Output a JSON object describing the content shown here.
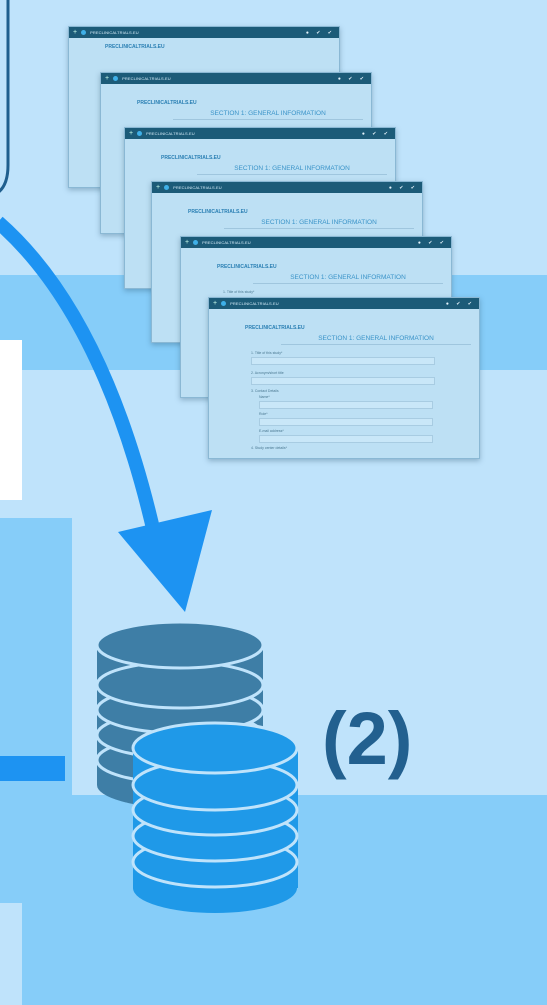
{
  "screens": {
    "site_name": "PRECLINICALTRIALS.EU",
    "logo": "PRECLINICALTRIALS.EU",
    "section_title": "SECTION 1: GENERAL INFORMATION",
    "fields": {
      "title": "1. Title of this study*",
      "acronym": "2. Acronym/short title",
      "contact": "3. Contact Details",
      "name": "Name*",
      "role": "Role*",
      "email": "E-mail address*",
      "centre": "4. Study center details*"
    }
  },
  "label": "(2)"
}
